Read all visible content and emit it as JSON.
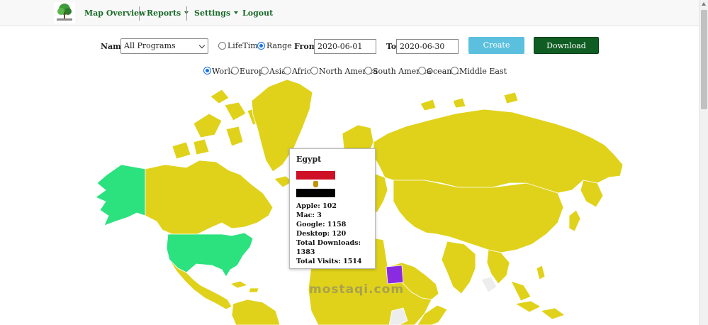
{
  "navbar": {
    "items": [
      {
        "label": "Map Overview"
      },
      {
        "label": "Reports"
      },
      {
        "label": "Settings"
      },
      {
        "label": "Logout"
      }
    ]
  },
  "filters": {
    "name_label": "Name",
    "program_value": "All Programs",
    "lifetime_label": "LifeTime",
    "range_label": "Range",
    "range_selected": "Range",
    "from_label": "From",
    "from_value": "2020-06-01",
    "to_label": "To",
    "to_value": "2020-06-30",
    "create_label": "Create Report",
    "download_label": "Download Report"
  },
  "regions": {
    "selected": "World",
    "items": [
      "World",
      "Europe",
      "Asia",
      "Africa",
      "North America",
      "South America",
      "Oceania",
      "Middle East"
    ]
  },
  "map": {
    "colors": {
      "default": "#e0d21b",
      "highlight_green": "#2be27e",
      "highlight_purple": "#8a2be2",
      "no_data": "#ededed"
    }
  },
  "tooltip": {
    "country": "Egypt",
    "flag_colors": [
      "#ce1126",
      "#ffffff",
      "#000000"
    ],
    "apple": "Apple: 102",
    "mac": "Mac: 3",
    "google": "Google: 1158",
    "desktop": "Desktop: 120",
    "total_downloads_label": "Total Downloads:",
    "total_downloads_value": "1383",
    "total_visits": "Total Visits: 1514"
  },
  "watermark": "mostaqi.com"
}
